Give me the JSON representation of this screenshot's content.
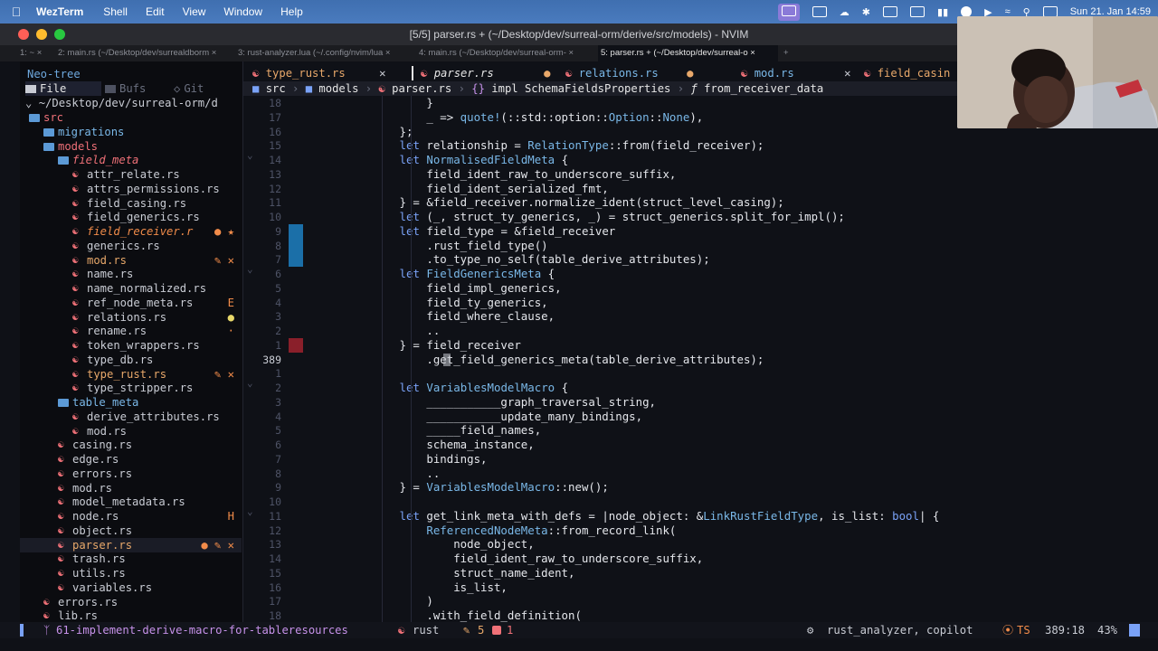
{
  "menubar": {
    "app": "WezTerm",
    "items": [
      "Shell",
      "Edit",
      "View",
      "Window",
      "Help"
    ],
    "clock": "Sun 21. Jan 14:59"
  },
  "window": {
    "title": "[5/5] parser.rs + (~/Desktop/dev/surreal-orm/derive/src/models) - NVIM"
  },
  "wezterm_tabs": [
    "1: ~ ×",
    "2: main.rs (~/Desktop/dev/surrealdborm ×",
    "3: rust-analyzer.lua (~/.config/nvim/lua ×",
    "4: main.rs (~/Desktop/dev/surreal-orm- ×",
    "5: parser.rs + (~/Desktop/dev/surreal-o ×"
  ],
  "sidebar": {
    "title": "Neo-tree",
    "sources": [
      "File",
      "Bufs",
      "Git"
    ],
    "root": "~/Desktop/dev/surreal-orm/d",
    "tree": [
      {
        "name": "src",
        "kind": "dir",
        "level": 1,
        "color": "#f07178"
      },
      {
        "name": "migrations",
        "kind": "dir",
        "level": 2,
        "color": "#7ab8e8"
      },
      {
        "name": "models",
        "kind": "dir",
        "level": 2,
        "color": "#f07178"
      },
      {
        "name": "field_meta",
        "kind": "dir",
        "level": 3,
        "color": "#f07178",
        "italic": true
      },
      {
        "name": "attr_relate.rs",
        "kind": "file",
        "level": 4
      },
      {
        "name": "attrs_permissions.rs",
        "kind": "file",
        "level": 4
      },
      {
        "name": "field_casing.rs",
        "kind": "file",
        "level": 4
      },
      {
        "name": "field_generics.rs",
        "kind": "file",
        "level": 4
      },
      {
        "name": "field_receiver.r",
        "kind": "file",
        "level": 4,
        "color": "#f28c4a",
        "italic": true,
        "mark": "● ★"
      },
      {
        "name": "generics.rs",
        "kind": "file",
        "level": 4
      },
      {
        "name": "mod.rs",
        "kind": "file",
        "level": 4,
        "color": "#e8a86a",
        "mark": "✎ ✕"
      },
      {
        "name": "name.rs",
        "kind": "file",
        "level": 4
      },
      {
        "name": "name_normalized.rs",
        "kind": "file",
        "level": 4
      },
      {
        "name": "ref_node_meta.rs",
        "kind": "file",
        "level": 4,
        "mark": "E"
      },
      {
        "name": "relations.rs",
        "kind": "file",
        "level": 4,
        "mark": "●"
      },
      {
        "name": "rename.rs",
        "kind": "file",
        "level": 4,
        "mark": "·"
      },
      {
        "name": "token_wrappers.rs",
        "kind": "file",
        "level": 4
      },
      {
        "name": "type_db.rs",
        "kind": "file",
        "level": 4
      },
      {
        "name": "type_rust.rs",
        "kind": "file",
        "level": 4,
        "color": "#e8a86a",
        "mark": "✎ ✕"
      },
      {
        "name": "type_stripper.rs",
        "kind": "file",
        "level": 4
      },
      {
        "name": "table_meta",
        "kind": "dir",
        "level": 3,
        "color": "#7ab8e8"
      },
      {
        "name": "derive_attributes.rs",
        "kind": "file",
        "level": 4
      },
      {
        "name": "mod.rs",
        "kind": "file",
        "level": 4
      },
      {
        "name": "casing.rs",
        "kind": "file",
        "level": 3
      },
      {
        "name": "edge.rs",
        "kind": "file",
        "level": 3
      },
      {
        "name": "errors.rs",
        "kind": "file",
        "level": 3
      },
      {
        "name": "mod.rs",
        "kind": "file",
        "level": 3
      },
      {
        "name": "model_metadata.rs",
        "kind": "file",
        "level": 3
      },
      {
        "name": "node.rs",
        "kind": "file",
        "level": 3,
        "mark": "H"
      },
      {
        "name": "object.rs",
        "kind": "file",
        "level": 3
      },
      {
        "name": "parser.rs",
        "kind": "file",
        "level": 3,
        "color": "#e8a86a",
        "mark": "● ✎ ✕",
        "selected": true
      },
      {
        "name": "trash.rs",
        "kind": "file",
        "level": 3
      },
      {
        "name": "utils.rs",
        "kind": "file",
        "level": 3
      },
      {
        "name": "variables.rs",
        "kind": "file",
        "level": 3
      },
      {
        "name": "errors.rs",
        "kind": "file",
        "level": 2
      },
      {
        "name": "lib.rs",
        "kind": "file",
        "level": 2
      }
    ]
  },
  "editor_tabs": [
    {
      "label": "type_rust.rs",
      "mark": "✕",
      "active": false
    },
    {
      "label": "parser.rs",
      "mark": "●",
      "active": true
    },
    {
      "label": "relations.rs",
      "mark": "●",
      "active": false
    },
    {
      "label": "mod.rs",
      "mark": "✕",
      "active": false
    },
    {
      "label": "field_casin",
      "mark": "",
      "active": false
    }
  ],
  "breadcrumb": {
    "src": "src",
    "models": "models",
    "file": "parser.rs",
    "impl": "impl SchemaFieldsProperties",
    "fn": "from_receiver_data"
  },
  "code_lines": [
    {
      "n": "18",
      "text": "                }"
    },
    {
      "n": "17",
      "text": "                _ => quote!(::std::option::Option::None),"
    },
    {
      "n": "16",
      "text": "            };"
    },
    {
      "n": "15",
      "text": "            let relationship = RelationType::from(field_receiver);"
    },
    {
      "n": "14",
      "text": "            let NormalisedFieldMeta {"
    },
    {
      "n": "13",
      "text": "                field_ident_raw_to_underscore_suffix,"
    },
    {
      "n": "12",
      "text": "                field_ident_serialized_fmt,"
    },
    {
      "n": "11",
      "text": "            } = &field_receiver.normalize_ident(struct_level_casing);"
    },
    {
      "n": "10",
      "text": "            let (_, struct_ty_generics, _) = struct_generics.split_for_impl();"
    },
    {
      "n": "9",
      "text": "            let field_type = &field_receiver"
    },
    {
      "n": "8",
      "text": "                .rust_field_type()"
    },
    {
      "n": "7",
      "text": "                .to_type_no_self(table_derive_attributes);"
    },
    {
      "n": "6",
      "text": "            let FieldGenericsMeta {"
    },
    {
      "n": "5",
      "text": "                field_impl_generics,"
    },
    {
      "n": "4",
      "text": "                field_ty_generics,"
    },
    {
      "n": "3",
      "text": "                field_where_clause,"
    },
    {
      "n": "2",
      "text": "                .."
    },
    {
      "n": "1",
      "text": "            } = field_receiver"
    },
    {
      "n": "389",
      "text": "                .get_field_generics_meta(table_derive_attributes);"
    },
    {
      "n": "1",
      "text": ""
    },
    {
      "n": "2",
      "text": "            let VariablesModelMacro {"
    },
    {
      "n": "3",
      "text": "                ___________graph_traversal_string,"
    },
    {
      "n": "4",
      "text": "                ___________update_many_bindings,"
    },
    {
      "n": "5",
      "text": "                _____field_names,"
    },
    {
      "n": "6",
      "text": "                schema_instance,"
    },
    {
      "n": "7",
      "text": "                bindings,"
    },
    {
      "n": "8",
      "text": "                .."
    },
    {
      "n": "9",
      "text": "            } = VariablesModelMacro::new();"
    },
    {
      "n": "10",
      "text": ""
    },
    {
      "n": "11",
      "text": "            let get_link_meta_with_defs = |node_object: &LinkRustFieldType, is_list: bool| {"
    },
    {
      "n": "12",
      "text": "                ReferencedNodeMeta::from_record_link("
    },
    {
      "n": "13",
      "text": "                    node_object,"
    },
    {
      "n": "14",
      "text": "                    field_ident_raw_to_underscore_suffix,"
    },
    {
      "n": "15",
      "text": "                    struct_name_ident,"
    },
    {
      "n": "16",
      "text": "                    is_list,"
    },
    {
      "n": "17",
      "text": "                )"
    },
    {
      "n": "18",
      "text": "                .with_field_definition("
    }
  ],
  "status": {
    "branch": "61-implement-derive-macro-for-tableresources",
    "filetype": "rust",
    "edits": "5",
    "errors": "1",
    "lsp": "rust_analyzer, copilot",
    "ts": "TS",
    "position": "389:18",
    "percent": "43%"
  },
  "colors": {
    "accent": "#7aa2f7",
    "type": "#7ab8e8",
    "modified": "#e8a86a",
    "error": "#f07178"
  }
}
